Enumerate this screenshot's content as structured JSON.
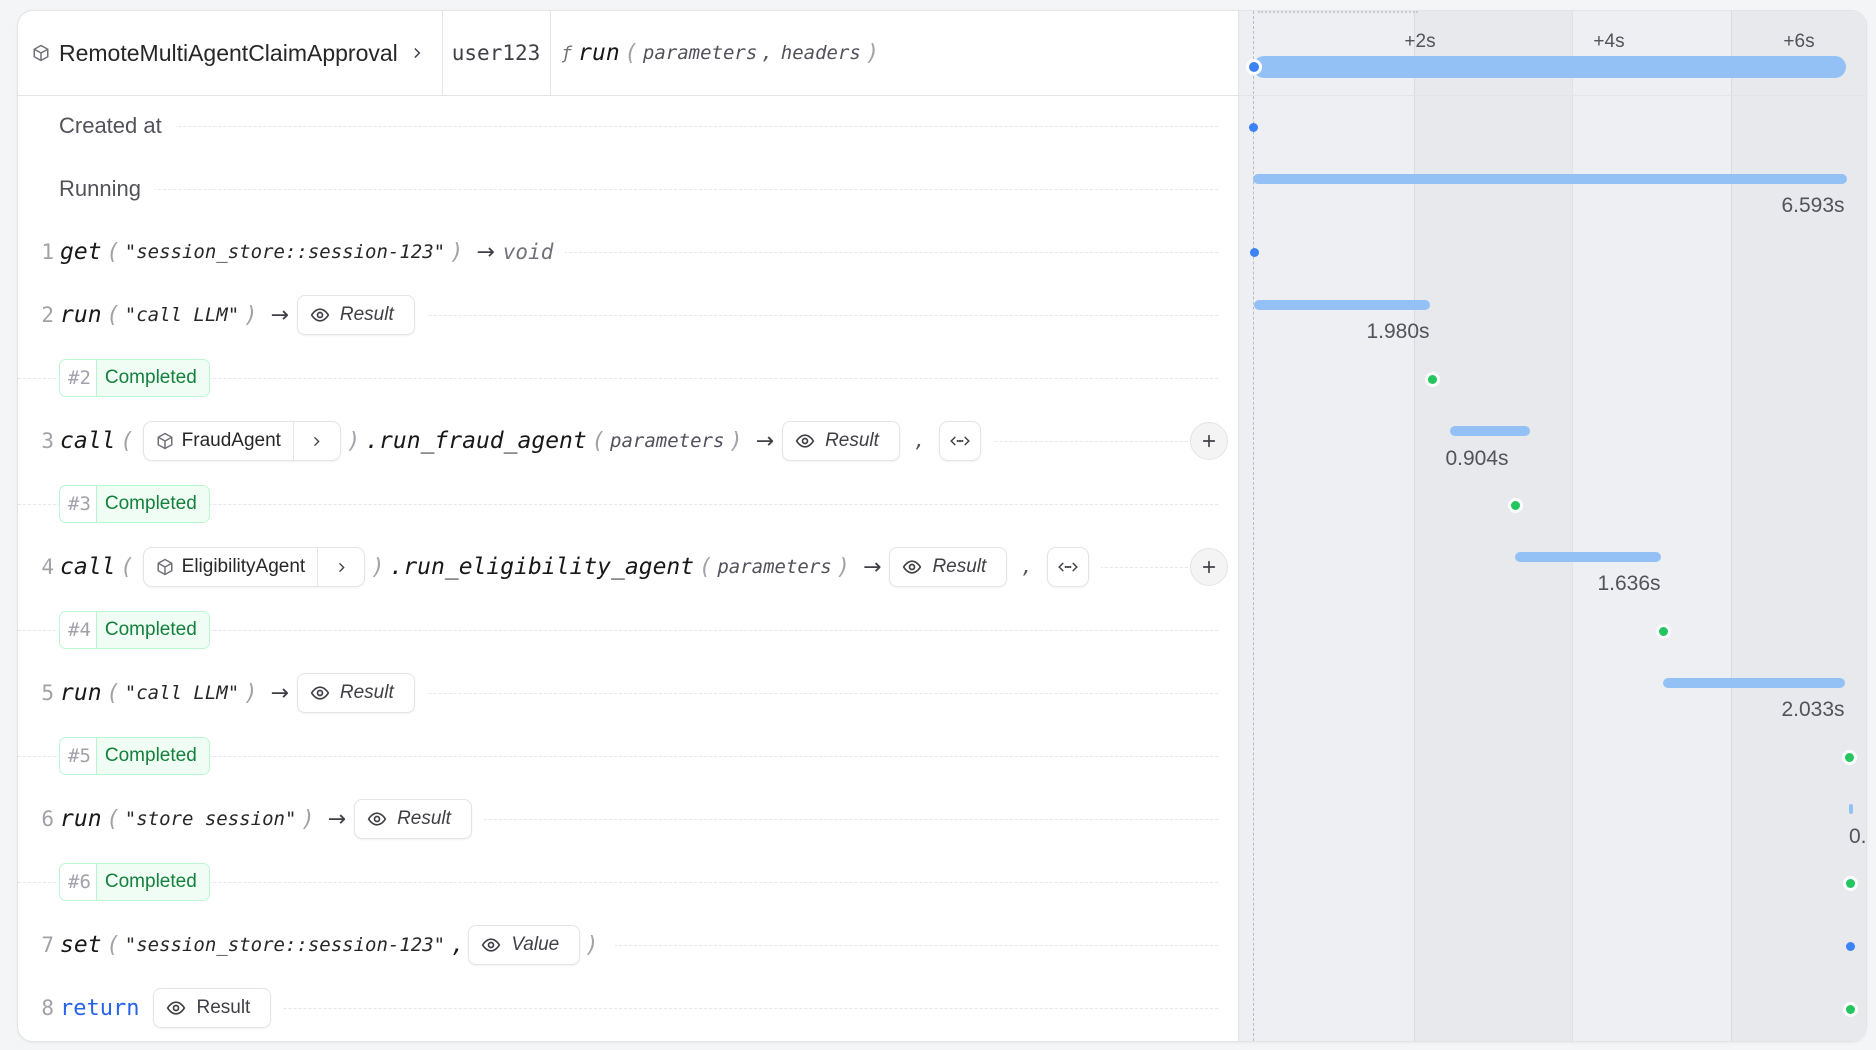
{
  "header": {
    "workflow_name": "RemoteMultiAgentClaimApproval",
    "key": "user123",
    "handler": {
      "fn_symbol": "ƒ",
      "name": "run",
      "open": "(",
      "args": [
        "parameters",
        "headers"
      ],
      "close": ")"
    }
  },
  "timeline": {
    "ticks": [
      "+2s",
      "+4s",
      "+6s"
    ],
    "total_duration_s": 6.593
  },
  "rows": {
    "created": {
      "label": "Created at"
    },
    "running": {
      "label": "Running",
      "duration": "6.593s"
    },
    "s1": {
      "line": "1",
      "fn": "get",
      "arg": "\"session_store::session-123\"",
      "arrow": "→",
      "returns": "void"
    },
    "s2": {
      "line": "2",
      "fn": "run",
      "arg": "\"call LLM\"",
      "arrow": "→",
      "result": "Result",
      "duration": "1.980s"
    },
    "c2": {
      "num": "#2",
      "status": "Completed"
    },
    "s3": {
      "line": "3",
      "fn": "call",
      "agent": "FraudAgent",
      "method": ".run_fraud_agent",
      "arg": "parameters",
      "arrow": "→",
      "result": "Result",
      "comma": ",",
      "duration": "0.904s"
    },
    "c3": {
      "num": "#3",
      "status": "Completed"
    },
    "s4": {
      "line": "4",
      "fn": "call",
      "agent": "EligibilityAgent",
      "method": ".run_eligibility_agent",
      "arg": "parameters",
      "arrow": "→",
      "result": "Result",
      "comma": ",",
      "duration": "1.636s"
    },
    "c4": {
      "num": "#4",
      "status": "Completed"
    },
    "s5": {
      "line": "5",
      "fn": "run",
      "arg": "\"call LLM\"",
      "arrow": "→",
      "result": "Result",
      "duration": "2.033s"
    },
    "c5": {
      "num": "#5",
      "status": "Completed"
    },
    "s6": {
      "line": "6",
      "fn": "run",
      "arg": "\"store session\"",
      "arrow": "→",
      "result": "Result",
      "duration": "0."
    },
    "c6": {
      "num": "#6",
      "status": "Completed"
    },
    "s7": {
      "line": "7",
      "fn": "set",
      "arg": "\"session_store::session-123\"",
      "comma": ",",
      "value": "Value"
    },
    "s8": {
      "line": "8",
      "fn": "return",
      "result": "Result"
    }
  },
  "colors": {
    "bar": "#93c1f5",
    "completed_text": "#15803d",
    "return_keyword": "#2563eb",
    "dot_blue": "#3b82f6",
    "dot_green": "#22c55e"
  },
  "icons": {
    "workflow": "cube-icon",
    "result": "eye-icon",
    "agent": "cube-icon",
    "navigate": "chevron-right-icon",
    "code": "code-brackets-icon",
    "add": "plus-icon"
  }
}
